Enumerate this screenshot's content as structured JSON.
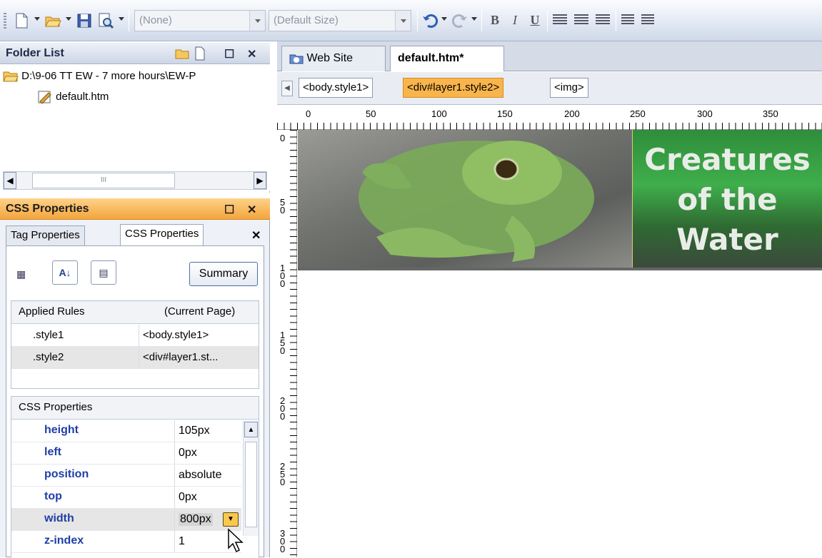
{
  "toolbar": {
    "style_combo": "(None)",
    "size_combo": "(Default Size)",
    "bold": "B",
    "italic": "I",
    "underline": "U"
  },
  "folder_list": {
    "title": "Folder List",
    "root": "D:\\9-06 TT EW - 7 more hours\\EW-P",
    "file": "default.htm",
    "hscroll_glyph": "III"
  },
  "css_panel": {
    "title": "CSS Properties",
    "tabs": [
      "Tag Properties",
      "CSS Properties"
    ],
    "summary_button": "Summary",
    "applied_rules_header": "Applied Rules",
    "applied_rules_scope": "(Current Page)",
    "rules": [
      {
        "name": ".style1",
        "target": "<body.style1>"
      },
      {
        "name": ".style2",
        "target": "<div#layer1.st..."
      }
    ],
    "properties_header": "CSS Properties",
    "properties": [
      {
        "name": "height",
        "value": "105px"
      },
      {
        "name": "left",
        "value": "0px"
      },
      {
        "name": "position",
        "value": "absolute"
      },
      {
        "name": "top",
        "value": "0px"
      },
      {
        "name": "width",
        "value": "800px"
      },
      {
        "name": "z-index",
        "value": "1"
      }
    ]
  },
  "document": {
    "tabs": [
      "Web Site",
      "default.htm*"
    ],
    "tag_selector": [
      "<body.style1>",
      "<div#layer1.style2>",
      "<img>"
    ],
    "ruler_top": [
      "0",
      "50",
      "100",
      "150",
      "200",
      "250",
      "300",
      "350"
    ],
    "ruler_left": [
      "0",
      "50",
      "100",
      "150",
      "200",
      "250",
      "300"
    ],
    "banner_title_lines": [
      "Creatures",
      "of the",
      "Water"
    ]
  }
}
